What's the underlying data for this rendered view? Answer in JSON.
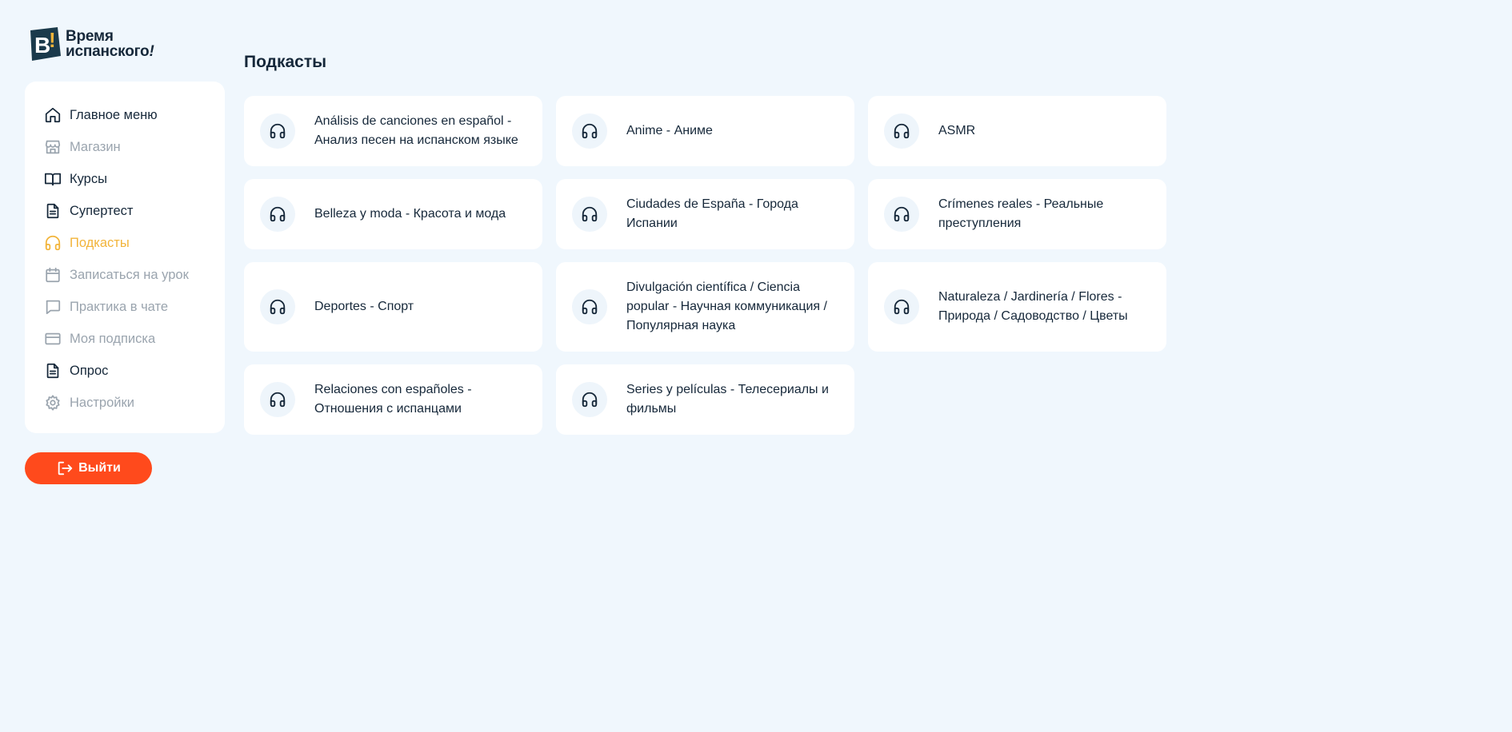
{
  "brand": {
    "logo_letter": "B",
    "logo_line1": "Время",
    "logo_line2": "испанского",
    "logo_excl": "!"
  },
  "colors": {
    "background": "#f0f7fd",
    "text": "#16283a",
    "muted": "#9aa4ae",
    "active": "#f2b43a",
    "logout": "#ff4a1c",
    "logo_dark": "#1b3a4b",
    "logo_accent": "#f2b43a"
  },
  "sidebar": {
    "items": [
      {
        "label": "Главное меню",
        "icon": "home-icon"
      },
      {
        "label": "Магазин",
        "icon": "store-icon"
      },
      {
        "label": "Курсы",
        "icon": "book-icon"
      },
      {
        "label": "Супертест",
        "icon": "document-icon"
      },
      {
        "label": "Подкасты",
        "icon": "headphones-icon"
      },
      {
        "label": "Записаться на урок",
        "icon": "calendar-icon"
      },
      {
        "label": "Практика в чате",
        "icon": "chat-icon"
      },
      {
        "label": "Моя подписка",
        "icon": "card-icon"
      },
      {
        "label": "Опрос",
        "icon": "document-icon"
      },
      {
        "label": "Настройки",
        "icon": "gear-icon"
      }
    ],
    "logout_label": "Выйти"
  },
  "main": {
    "title": "Подкасты",
    "podcasts": [
      {
        "title": "Análisis de canciones en español - Анализ песен на испанском языке"
      },
      {
        "title": "Anime - Аниме"
      },
      {
        "title": "ASMR"
      },
      {
        "title": "Belleza y moda - Красота и мода"
      },
      {
        "title": "Ciudades de España - Города Испании"
      },
      {
        "title": "Crímenes reales - Реальные преступления"
      },
      {
        "title": "Deportes - Спорт"
      },
      {
        "title": "Divulgación científica / Ciencia popular - Научная коммуникация / Популярная наука"
      },
      {
        "title": "Naturaleza / Jardinería / Flores - Природа / Садоводство / Цветы"
      },
      {
        "title": "Relaciones con españoles - Отношения с испанцами"
      },
      {
        "title": "Series y películas - Телесериалы и фильмы"
      }
    ]
  }
}
